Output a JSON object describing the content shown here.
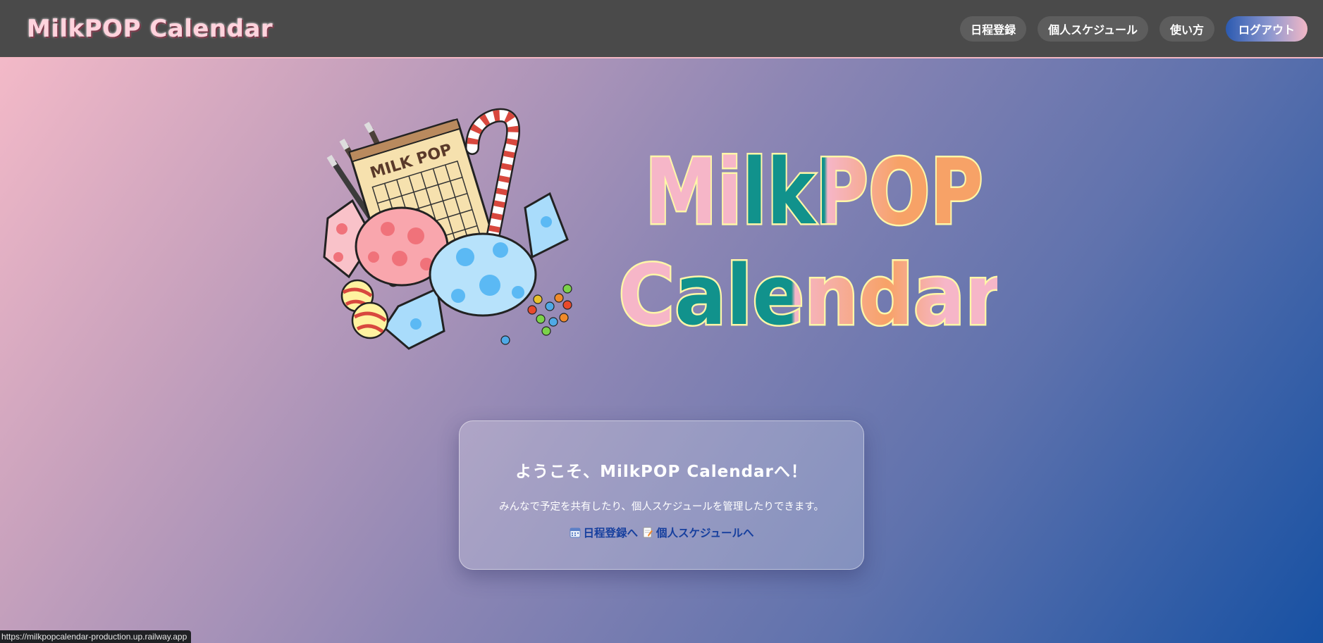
{
  "header": {
    "brand": "MilkPOP Calendar",
    "nav": {
      "schedule_register": "日程登録",
      "personal_schedule": "個人スケジュール",
      "usage": "使い方",
      "logout": "ログアウト"
    }
  },
  "hero": {
    "art_label": "MILK POP",
    "logo_line1": "MilkPOP",
    "logo_line2": "Calendar"
  },
  "welcome": {
    "title": "ようこそ、MilkPOP Calendarへ！",
    "description": "みんなで予定を共有したり、個人スケジュールを管理したりできます。",
    "link_schedule": "日程登録へ",
    "link_personal": "個人スケジュールへ"
  },
  "status_url": "https://milkpopcalendar-production.up.railway.app",
  "colors": {
    "header_bg": "#4a4a4a",
    "brand_pink": "#ffd3dd",
    "logo_pink": "#f6b6c8",
    "logo_teal": "#11928c",
    "logo_orange": "#f7a267",
    "logo_outline": "#fff7a8",
    "link_blue": "#163f9e"
  }
}
